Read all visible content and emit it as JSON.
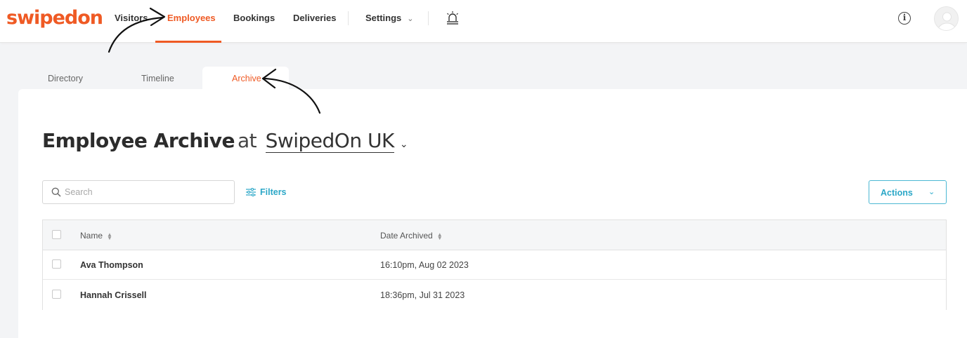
{
  "brand": {
    "logo": "swipedon",
    "accent": "#ef5a24",
    "link_color": "#2ba7c7"
  },
  "nav": {
    "items": [
      "Visitors",
      "Employees",
      "Bookings",
      "Deliveries",
      "Settings"
    ],
    "active": "Employees",
    "icons": [
      "alarm-icon",
      "info-icon",
      "avatar"
    ]
  },
  "tabs": [
    "Directory",
    "Timeline",
    "Archive"
  ],
  "active_tab": "Archive",
  "page": {
    "title": "Employee Archive",
    "at": "at",
    "location": "SwipedOn UK"
  },
  "search": {
    "placeholder": "Search"
  },
  "filters_label": "Filters",
  "actions_label": "Actions",
  "table": {
    "columns": [
      "Name",
      "Date Archived"
    ],
    "rows": [
      {
        "name": "Ava Thompson",
        "date": "16:10pm, Aug 02 2023"
      },
      {
        "name": "Hannah Crissell",
        "date": "18:36pm, Jul 31 2023"
      }
    ]
  }
}
